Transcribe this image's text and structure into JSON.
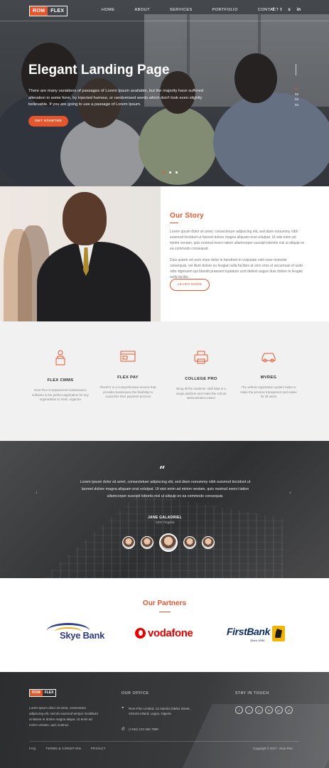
{
  "brand": {
    "logo_left": "ROM",
    "logo_right": "FLEX",
    "accent": "#e4572e"
  },
  "nav": {
    "items": [
      {
        "label": "HOME"
      },
      {
        "label": "ABOUT"
      },
      {
        "label": "SERVICES"
      },
      {
        "label": "PORTFOLIO"
      },
      {
        "label": "CONTACT"
      }
    ],
    "social": [
      {
        "icon": "facebook-icon",
        "glyph": "f"
      },
      {
        "icon": "twitter-icon",
        "glyph": "t"
      },
      {
        "icon": "skype-icon",
        "glyph": "s"
      },
      {
        "icon": "linkedin-icon",
        "glyph": "in"
      }
    ]
  },
  "hero": {
    "title": "Elegant Landing Page",
    "text": "There are many variations of passages of Lorem Ipsum available, but the majority have suffered alteration in some form, by injected humour, or randomised words which don't look even slightly believable. If you are going to use a passage of Lorem Ipsum.",
    "button": "GET STARTED",
    "slide_numbers": [
      "01",
      "02",
      "03",
      "04"
    ]
  },
  "story": {
    "title": "Our Story",
    "p1": "Lorem ipsum dolor sit amet, consectetuer adipiscing elit, sed diam nonummy nibh euismod tincidunt ut laoreet dolore magna aliquam erat volutpat. Ut wisi enim ad minim veniam, quis nostrud exerci tation ullamcorper suscipit lobortis nisl ut aliquip ex ea commodo consequat.",
    "p2": "Duis autem vel eum iriure dolor in hendrerit in vulputate velit esse molestie consequat, vel illum dolore eu feugiat nulla facilisis at vero eros et accumsan et iusto odio dignissim qui blandit praesent luptatum zzril delenit augue duis dolore te feugait nulla facilisi.",
    "button": "LEARN MORE"
  },
  "services": [
    {
      "icon": "teacher-icon",
      "title": "FLEX CMMS",
      "text": "Rom-Flex Computerized maintenance software is the perfect application for any organization to track, organize"
    },
    {
      "icon": "payment-icon",
      "title": "FLEX PAY",
      "text": "FlexPAY is a comprehensive service that provides businesses the flexibility to customize their payment process"
    },
    {
      "icon": "printer-icon",
      "title": "COLLEGE PRO",
      "text": "Bring all the students, staff data in a single platform and make the school administration easier"
    },
    {
      "icon": "car-icon",
      "title": "MVREG",
      "text": "The vehicle registration system helps to make the process transparent and easier for all users"
    }
  ],
  "testimonial": {
    "text": "Lorem ipsum dolor sit amet, consectetuer adipiscing elit, sed diam nonummy nibh euismod tincidunt ut laoreet dolore magna aliquam erat volutpat. Ut wisi enim ad minim veniam, quis nostrud exerci tation ullamcorper suscipit lobortis nisl ut aliquip ex ea commodo consequat.",
    "name": "JANE GALADRIEL",
    "role": "CEO Tingsha"
  },
  "partners": {
    "title": "Our Partners",
    "skye": "Skye Bank",
    "vodafone": "vodafone",
    "firstbank": "FirstBank",
    "firstbank_since": "Since 1894"
  },
  "footer": {
    "logo_left": "ROM",
    "logo_right": "FLEX",
    "about": "Lorem ipsum dolor sit amet, consectetur adipiscing elit, sed do eiusmod tempor incididunt ut labore et dolore magna aliqua. Ut enim ad minim veniam, quis nostrud.",
    "office_heading": "OUR OFFICE",
    "address": "Rom-Flex Limited, 12 Adeola Odeku Street, Victoria Island, Lagos, Nigeria",
    "phone": "(+234) 123 456 7890",
    "stay_heading": "STAY IN TOUCH",
    "social": [
      "f",
      "t",
      "p",
      "in",
      "g+",
      "yt"
    ],
    "links": [
      "FAQ",
      "TERMS & CONDITION",
      "PRIVACY"
    ],
    "copyright": "Copyright © 2017 - Rom-Flex"
  }
}
